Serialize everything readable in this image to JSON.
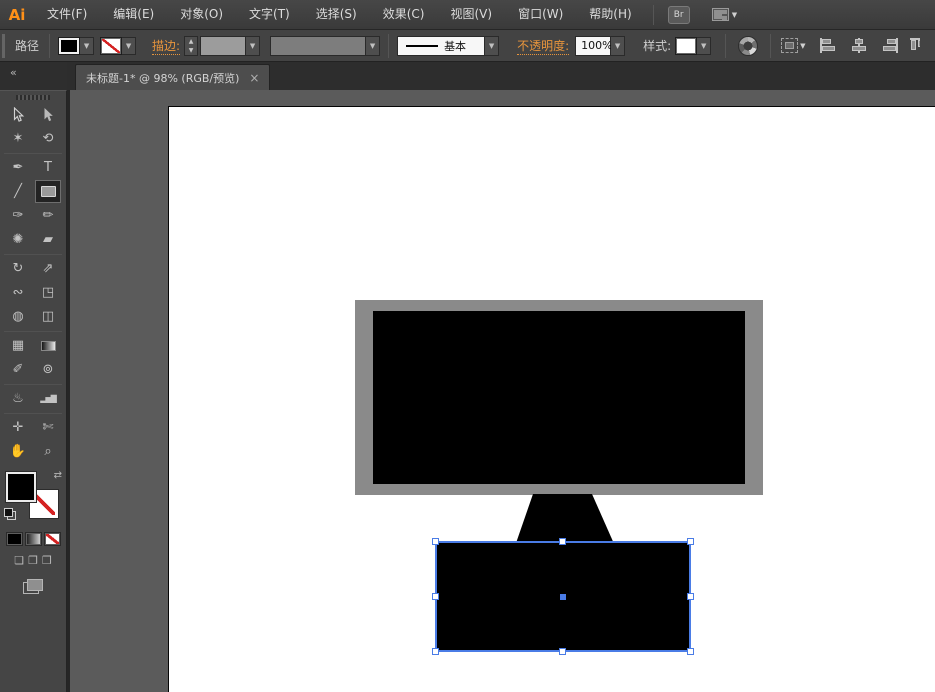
{
  "app": {
    "logo": "Ai"
  },
  "menu_bar": {
    "items": [
      "文件(F)",
      "编辑(E)",
      "对象(O)",
      "文字(T)",
      "选择(S)",
      "效果(C)",
      "视图(V)",
      "窗口(W)",
      "帮助(H)"
    ],
    "bridge_button_label": "Br"
  },
  "control_bar": {
    "selection_type_label": "路径",
    "stroke_label": "描边:",
    "stroke_width_value": "",
    "brush_definition_value": "基本",
    "opacity_label": "不透明度:",
    "opacity_value": "100%",
    "style_label": "样式:"
  },
  "document_tab": {
    "title": "未标题-1* @ 98% (RGB/预览)",
    "close_glyph": "×"
  },
  "icons": {
    "collapse": "«",
    "magic-wand": "✶",
    "lasso": "⟲",
    "pen": "✒",
    "type": "T",
    "line": "╱",
    "paintbrush": "✑",
    "pencil": "✏",
    "blob-brush": "✺",
    "eraser": "▰",
    "rotate": "↻",
    "scale": "⇗",
    "width-tool": "∾",
    "free-transform": "◳",
    "shape-builder": "◍",
    "perspective-grid": "◫",
    "mesh": "▦",
    "eyedropper": "✐",
    "blend": "⊚",
    "symbol-sprayer": "♨",
    "column-graph": "▂▅▇",
    "artboard-tool": "✛",
    "slice": "✄",
    "hand": "✋",
    "zoom": "⌕",
    "swap-fill-stroke": "⇄",
    "draw-normal": "❏",
    "draw-behind": "❐",
    "draw-inside": "❒",
    "dropdown": "▼",
    "stepper-up": "▲",
    "stepper-down": "▼"
  },
  "colors": {
    "accent_orange": "#e8953c",
    "selection_blue": "#4a7ce6",
    "monitor_frame_gray": "#8a8a8a",
    "artwork_black": "#000000",
    "artboard_white": "#ffffff"
  },
  "canvas": {
    "artwork": {
      "monitor_frame_color": "#8a8a8a",
      "monitor_screen_color": "#000000",
      "stand_color": "#000000",
      "base_color": "#000000"
    }
  }
}
